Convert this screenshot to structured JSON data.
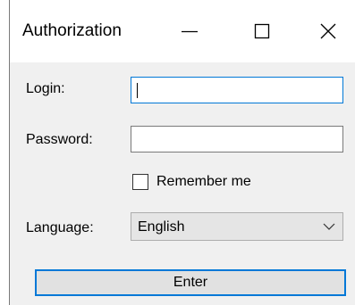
{
  "window": {
    "title": "Authorization",
    "controls": {
      "minimize_icon": "minimize-icon",
      "maximize_icon": "maximize-icon",
      "close_icon": "close-icon"
    }
  },
  "form": {
    "login_label": "Login:",
    "login_value": "",
    "password_label": "Password:",
    "password_value": "",
    "remember_label": "Remember me",
    "remember_checked": false,
    "language_label": "Language:",
    "language_selected": "English",
    "enter_label": "Enter"
  },
  "colors": {
    "focus_blue": "#0078d7",
    "dialog_bg": "#f0f0f0"
  }
}
